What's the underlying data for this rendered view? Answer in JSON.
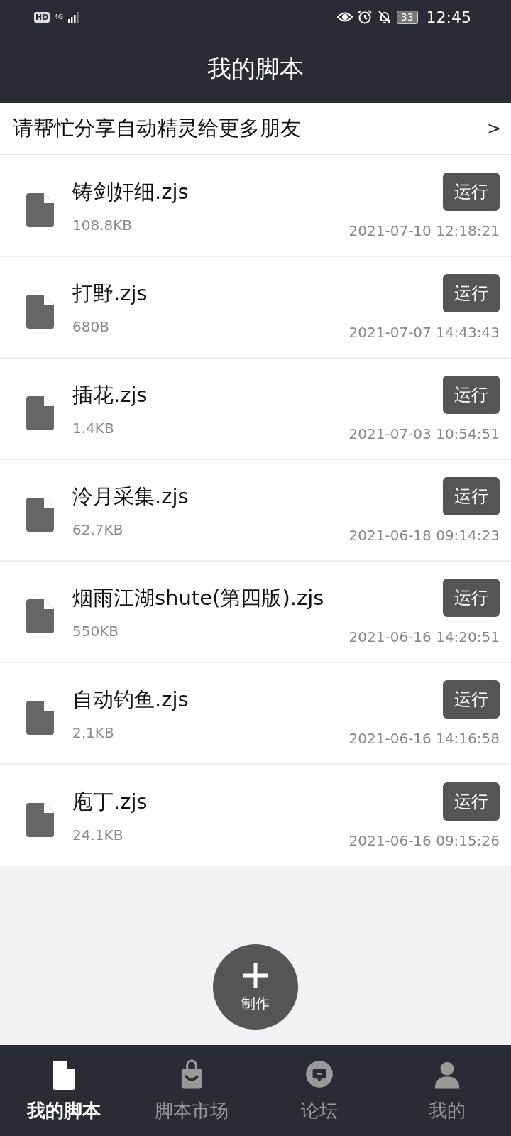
{
  "status_bar": {
    "hd": "HD",
    "network": "4G",
    "battery": "33",
    "time": "12:45"
  },
  "header": {
    "title": "我的脚本"
  },
  "share_banner": {
    "text": "请帮忙分享自动精灵给更多朋友",
    "arrow": ">"
  },
  "scripts": [
    {
      "name": "铸剑奸细.zjs",
      "size": "108.8KB",
      "date": "2021-07-10 12:18:21",
      "action": "运行"
    },
    {
      "name": "打野.zjs",
      "size": "680B",
      "date": "2021-07-07 14:43:43",
      "action": "运行"
    },
    {
      "name": "插花.zjs",
      "size": "1.4KB",
      "date": "2021-07-03 10:54:51",
      "action": "运行"
    },
    {
      "name": "泠月采集.zjs",
      "size": "62.7KB",
      "date": "2021-06-18 09:14:23",
      "action": "运行"
    },
    {
      "name": "烟雨江湖shute(第四版).zjs",
      "size": "550KB",
      "date": "2021-06-16 14:20:51",
      "action": "运行"
    },
    {
      "name": "自动钓鱼.zjs",
      "size": "2.1KB",
      "date": "2021-06-16 14:16:58",
      "action": "运行"
    },
    {
      "name": "庖丁.zjs",
      "size": "24.1KB",
      "date": "2021-06-16 09:15:26",
      "action": "运行"
    }
  ],
  "fab": {
    "label": "制作"
  },
  "tabs": [
    {
      "kind": "document",
      "label": "我的脚本",
      "selected": true
    },
    {
      "kind": "bag",
      "label": "脚本市场",
      "selected": false
    },
    {
      "kind": "chat",
      "label": "论坛",
      "selected": false
    },
    {
      "kind": "person",
      "label": "我的",
      "selected": false
    }
  ]
}
